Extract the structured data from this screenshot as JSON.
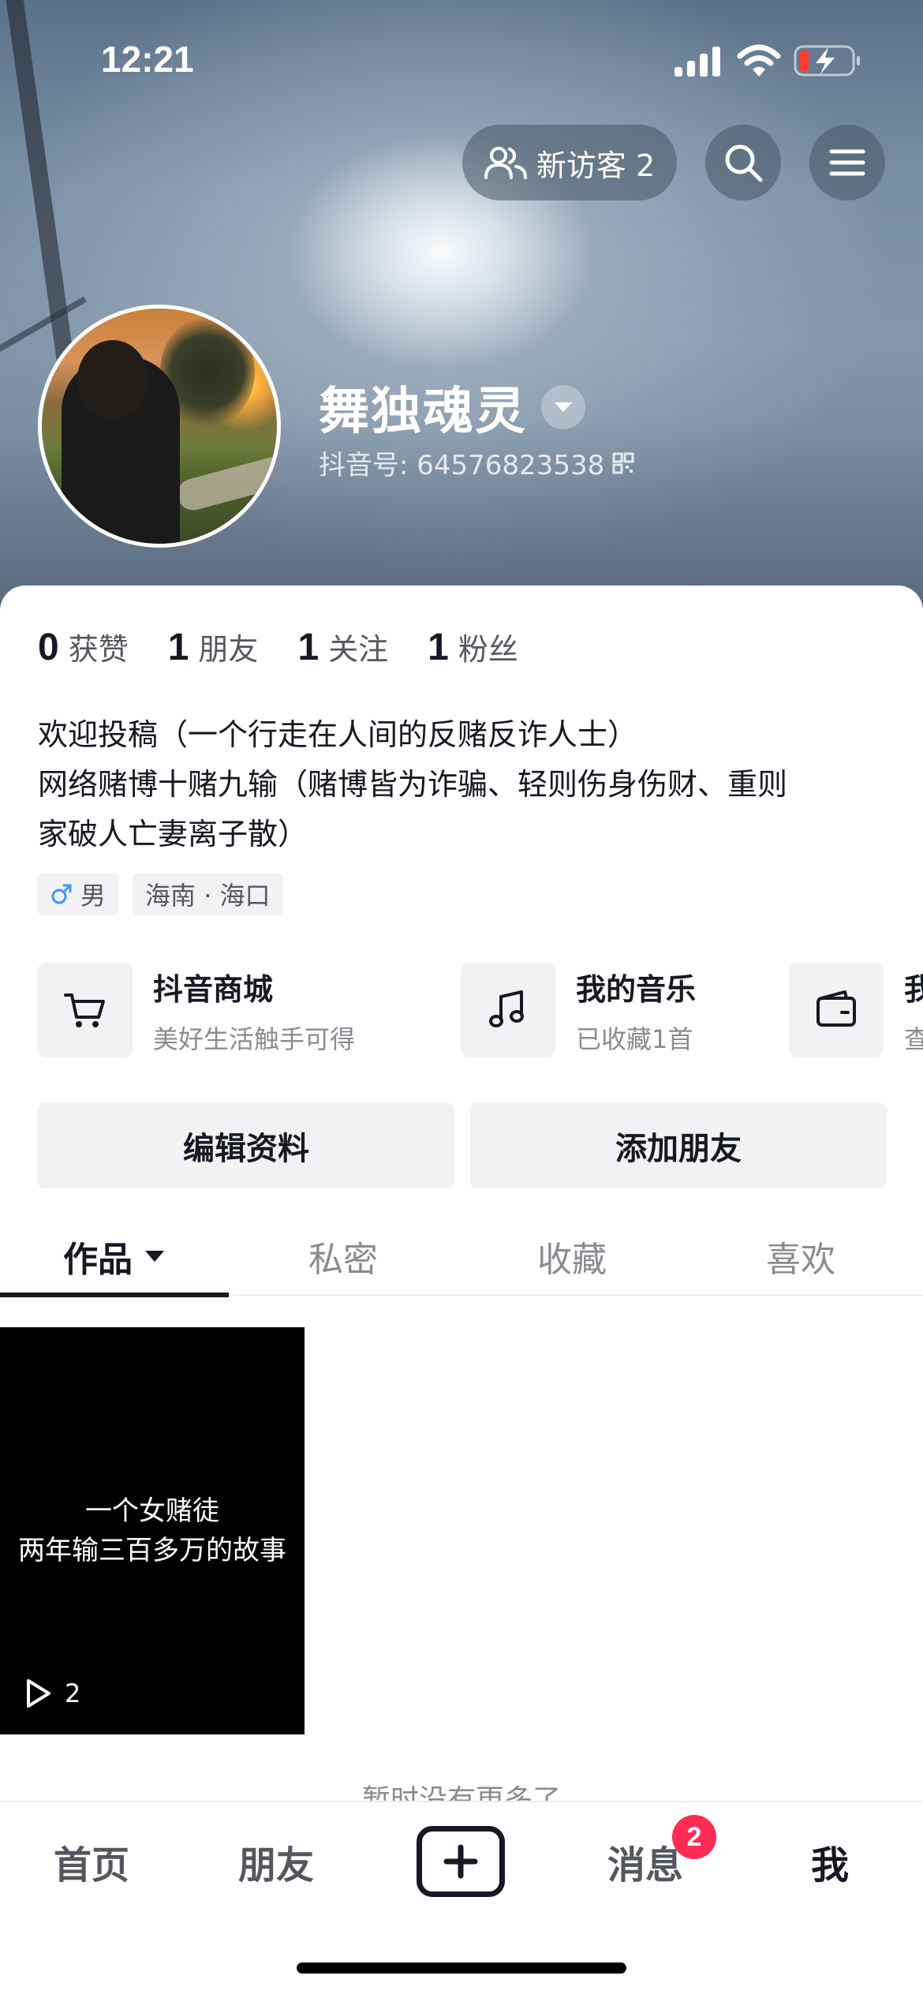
{
  "status_bar": {
    "time": "12:21",
    "icons": [
      "signal-icon",
      "wifi-icon",
      "battery-charging-icon"
    ]
  },
  "header": {
    "visitor_label": "新访客 2",
    "icons": [
      "visitors-icon",
      "search-icon",
      "menu-icon"
    ]
  },
  "profile": {
    "nickname": "舞独魂灵",
    "douyin_id": "抖音号: 64576823538",
    "stats": [
      {
        "num": "0",
        "label": "获赞"
      },
      {
        "num": "1",
        "label": "朋友"
      },
      {
        "num": "1",
        "label": "关注"
      },
      {
        "num": "1",
        "label": "粉丝"
      }
    ],
    "bio_lines": [
      "欢迎投稿（一个行走在人间的反赌反诈人士）",
      "网络赌博十赌九输（赌博皆为诈骗、轻则伤身伤财、重则",
      "家破人亡妻离子散）"
    ],
    "tags": {
      "gender": "男",
      "location": "海南 · 海口"
    }
  },
  "services": [
    {
      "icon": "cart-icon",
      "title": "抖音商城",
      "subtitle": "美好生活触手可得"
    },
    {
      "icon": "music-note-icon",
      "title": "我的音乐",
      "subtitle": "已收藏1首"
    },
    {
      "icon": "wallet-icon",
      "title": "我",
      "subtitle": "查"
    }
  ],
  "actions": {
    "edit_profile": "编辑资料",
    "add_friends": "添加朋友"
  },
  "tabs": [
    {
      "label": "作品",
      "active": true
    },
    {
      "label": "私密",
      "active": false
    },
    {
      "label": "收藏",
      "active": false
    },
    {
      "label": "喜欢",
      "active": false
    }
  ],
  "videos": [
    {
      "caption_lines": [
        "一个女赌徒",
        "两年输三百多万的故事"
      ],
      "play_count": "2"
    }
  ],
  "no_more_text": "暂时没有更多了",
  "bottom_nav": {
    "home": "首页",
    "friends": "朋友",
    "messages": "消息",
    "messages_badge": "2",
    "me": "我"
  },
  "colors": {
    "accent_red": "#fe2c55",
    "text_primary": "#161823",
    "text_secondary": "#8a8b91"
  }
}
